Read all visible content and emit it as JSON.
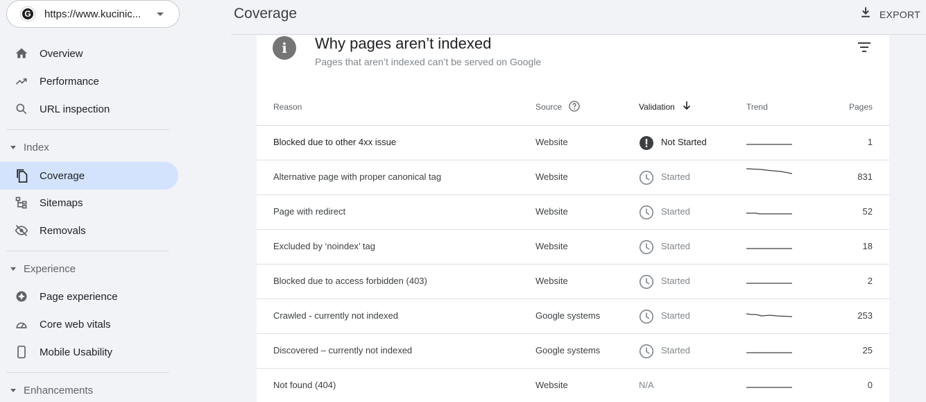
{
  "property": {
    "url": "https://www.kucinic...",
    "logo_letter": "G"
  },
  "header": {
    "title": "Coverage",
    "export_label": "EXPORT"
  },
  "sidebar": {
    "items_top": [
      {
        "label": "Overview",
        "icon": "home-icon"
      },
      {
        "label": "Performance",
        "icon": "trending-up-icon"
      },
      {
        "label": "URL inspection",
        "icon": "search-icon"
      }
    ],
    "index_label": "Index",
    "items_index": [
      {
        "label": "Coverage",
        "icon": "file-copy-icon",
        "active": true
      },
      {
        "label": "Sitemaps",
        "icon": "sitemap-icon"
      },
      {
        "label": "Removals",
        "icon": "eye-off-icon"
      }
    ],
    "experience_label": "Experience",
    "items_experience": [
      {
        "label": "Page experience",
        "icon": "plus-circle-icon"
      },
      {
        "label": "Core web vitals",
        "icon": "speed-icon"
      },
      {
        "label": "Mobile Usability",
        "icon": "phone-icon"
      }
    ],
    "enhancements_label": "Enhancements"
  },
  "card": {
    "title": "Why pages aren’t indexed",
    "subtitle": "Pages that aren’t indexed can’t be served on Google",
    "columns": {
      "reason": "Reason",
      "source": "Source",
      "validation": "Validation",
      "trend": "Trend",
      "pages": "Pages"
    },
    "rows": [
      {
        "reason": "Blocked due to other 4xx issue",
        "source": "Website",
        "validation": "Not Started",
        "status": "not-started",
        "pages": "1"
      },
      {
        "reason": "Alternative page with proper canonical tag",
        "source": "Website",
        "validation": "Started",
        "status": "started",
        "pages": "831"
      },
      {
        "reason": "Page with redirect",
        "source": "Website",
        "validation": "Started",
        "status": "started",
        "pages": "52"
      },
      {
        "reason": "Excluded by ‘noindex’ tag",
        "source": "Website",
        "validation": "Started",
        "status": "started",
        "pages": "18"
      },
      {
        "reason": "Blocked due to access forbidden (403)",
        "source": "Website",
        "validation": "Started",
        "status": "started",
        "pages": "2"
      },
      {
        "reason": "Crawled - currently not indexed",
        "source": "Google systems",
        "validation": "Started",
        "status": "started",
        "pages": "253"
      },
      {
        "reason": "Discovered – currently not indexed",
        "source": "Google systems",
        "validation": "Started",
        "status": "started",
        "pages": "25"
      },
      {
        "reason": "Not found (404)",
        "source": "Website",
        "validation": "N/A",
        "status": "na",
        "pages": "0"
      }
    ]
  }
}
